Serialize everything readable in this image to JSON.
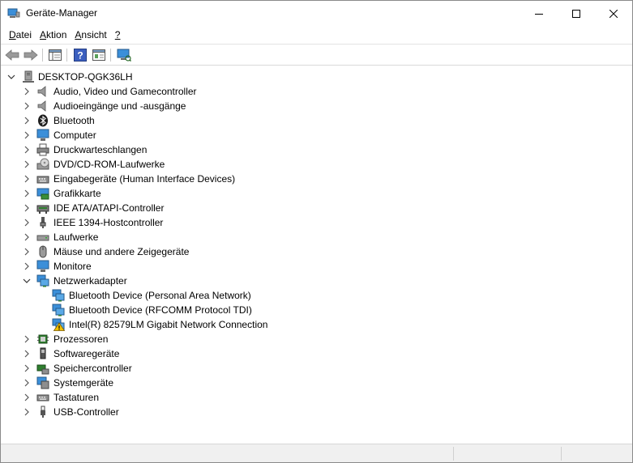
{
  "window": {
    "title": "Geräte-Manager"
  },
  "menu": {
    "items": [
      {
        "underline": "D",
        "rest": "atei"
      },
      {
        "underline": "A",
        "rest": "ktion"
      },
      {
        "underline": "A",
        "rest": "nsicht"
      },
      {
        "underline": "?",
        "rest": ""
      }
    ]
  },
  "tree": {
    "root": "DESKTOP-QGK36LH",
    "categories": [
      "Audio, Video und Gamecontroller",
      "Audioeingänge und -ausgänge",
      "Bluetooth",
      "Computer",
      "Druckwarteschlangen",
      "DVD/CD-ROM-Laufwerke",
      "Eingabegeräte (Human Interface Devices)",
      "Grafikkarte",
      "IDE ATA/ATAPI-Controller",
      "IEEE 1394-Hostcontroller",
      "Laufwerke",
      "Mäuse und andere Zeigegeräte",
      "Monitore",
      "Netzwerkadapter",
      "Prozessoren",
      "Softwaregeräte",
      "Speichercontroller",
      "Systemgeräte",
      "Tastaturen",
      "USB-Controller"
    ],
    "network_devices": [
      "Bluetooth Device (Personal Area Network)",
      "Bluetooth Device (RFCOMM Protocol TDI)",
      "Intel(R) 82579LM Gigabit Network Connection"
    ]
  },
  "colors": {
    "accent": "#1e7bd3",
    "warning": "#f2c200"
  }
}
